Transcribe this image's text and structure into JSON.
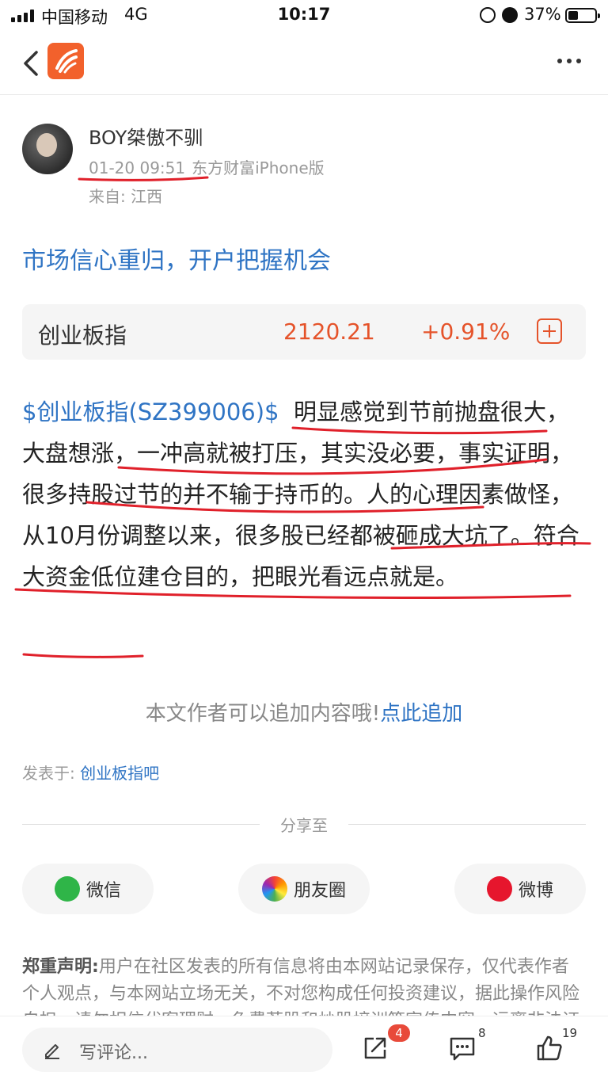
{
  "status_bar": {
    "carrier": "中国移动",
    "network": "4G",
    "time": "10:17",
    "battery": "37%",
    "battery_level": 0.37
  },
  "author": {
    "name": "BOY桀傲不驯",
    "timestamp": "01-20 09:51",
    "client": "东方财富iPhone版",
    "location": "来自: 江西"
  },
  "post": {
    "title": "市场信心重归，开户把握机会",
    "stock_card": {
      "name": "创业板指",
      "price": "2120.21",
      "change": "+0.91%"
    },
    "stock_tag": "$创业板指(SZ399006)$",
    "body": "明显感觉到节前抛盘很大，大盘想涨，一冲高就被打压，其实没必要，事实证明，很多持股过节的并不输于持币的。人的心理因素做怪，从10月份调整以来，很多股已经都被砸成大坑了。符合大资金低位建仓目的，把眼光看远点就是。",
    "append_prompt": "本文作者可以追加内容哦!",
    "append_link": "点此追加",
    "posted_in_label": "发表于:",
    "posted_in_bar": "创业板指吧"
  },
  "share": {
    "label": "分享至",
    "wechat": "微信",
    "moments": "朋友圈",
    "weibo": "微博"
  },
  "disclaimer": {
    "title": "郑重声明:",
    "text": "用户在社区发表的所有信息将由本网站记录保存，仅代表作者个人观点，与本网站立场无关，不对您构成任何投资建议，据此操作风险自担。请勿相信代客理财、免费荐股和炒股培训等宣传内容，远离非法证券活动。"
  },
  "bottom_bar": {
    "comment_placeholder": "写评论...",
    "share_badge": "4",
    "comment_count": "8",
    "like_count": "19"
  },
  "colors": {
    "link_blue": "#2f74c4",
    "price_red": "#e5532a",
    "brand_orange": "#f2612c",
    "annotation_red": "#e0202a"
  }
}
